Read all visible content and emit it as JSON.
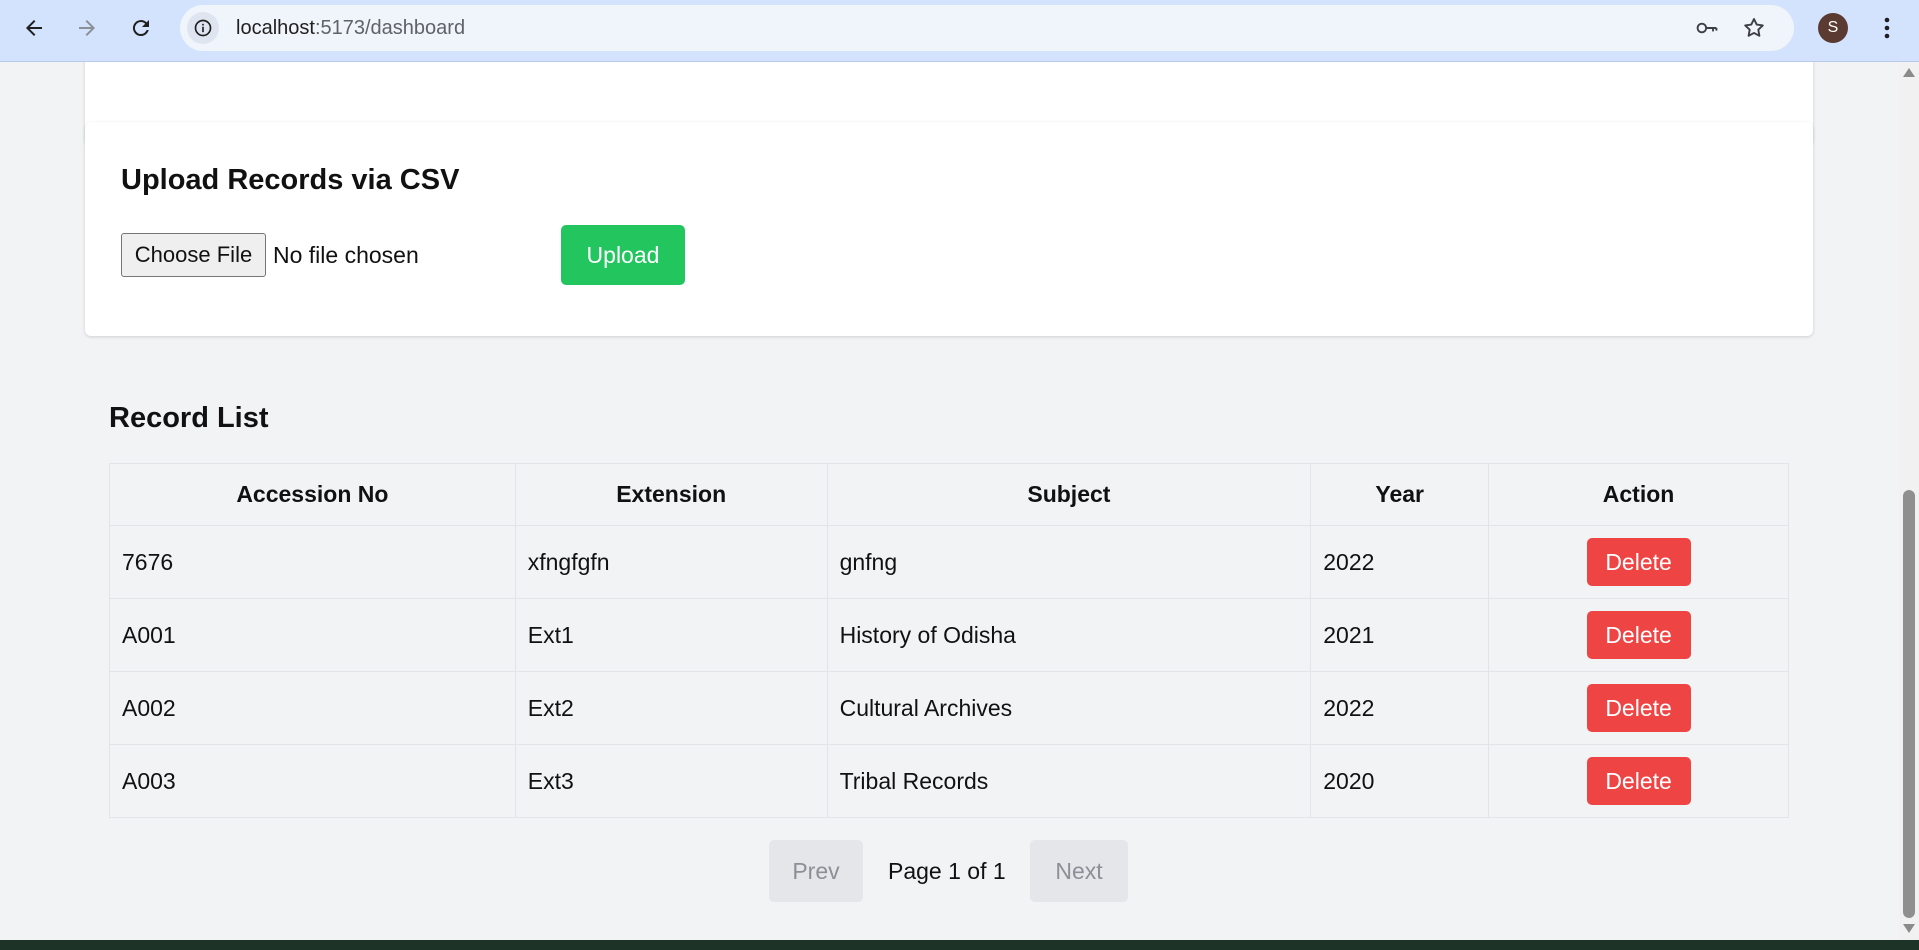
{
  "browser": {
    "url_host": "localhost",
    "url_path": ":5173/dashboard",
    "profile_initial": "S"
  },
  "upload": {
    "title": "Upload Records via CSV",
    "choose_file_label": "Choose File",
    "file_status": "No file chosen",
    "upload_label": "Upload"
  },
  "record_list": {
    "title": "Record List",
    "columns": [
      "Accession No",
      "Extension",
      "Subject",
      "Year",
      "Action"
    ],
    "rows": [
      {
        "accession": "7676",
        "extension": "xfngfgfn",
        "subject": "gnfng",
        "year": "2022",
        "action": "Delete"
      },
      {
        "accession": "A001",
        "extension": "Ext1",
        "subject": "History of Odisha",
        "year": "2021",
        "action": "Delete"
      },
      {
        "accession": "A002",
        "extension": "Ext2",
        "subject": "Cultural Archives",
        "year": "2022",
        "action": "Delete"
      },
      {
        "accession": "A003",
        "extension": "Ext3",
        "subject": "Tribal Records",
        "year": "2020",
        "action": "Delete"
      }
    ]
  },
  "pagination": {
    "prev_label": "Prev",
    "page_info": "Page 1 of 1",
    "next_label": "Next"
  },
  "colors": {
    "upload_button": "#22c55e",
    "delete_button": "#ef4444",
    "page_background": "#f2f3f5",
    "chrome_background": "#d3e3fd"
  },
  "icons": {
    "back": "arrow-left-icon",
    "forward": "arrow-right-icon",
    "reload": "reload-icon",
    "site_info": "info-icon",
    "password": "key-icon",
    "bookmark": "star-icon",
    "menu": "kebab-menu-icon"
  }
}
